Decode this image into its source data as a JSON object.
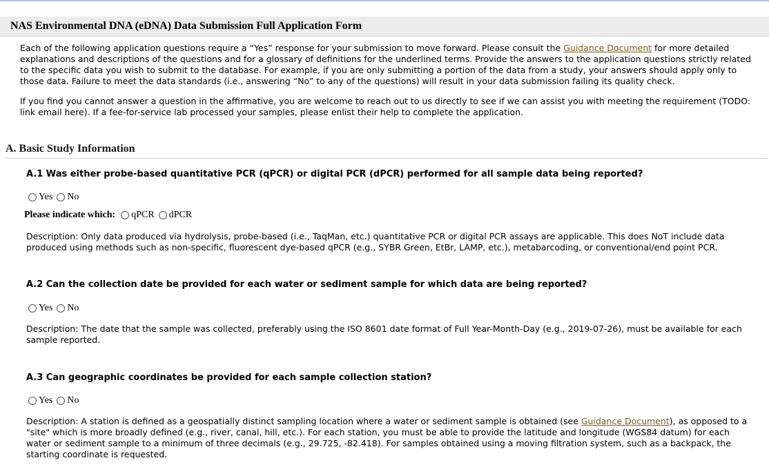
{
  "header": {
    "title": "NAS Environmental DNA (eDNA) Data Submission Full Application Form"
  },
  "intro": {
    "p1_before": "Each of the following application questions require a “Yes” response for your submission to move forward. Please consult the ",
    "p1_link": "Guidance Document",
    "p1_after": " for more detailed explanations and descriptions of the questions and for a glossary of definitions for the underlined terms. Provide the answers to the application questions strictly related to the specific data you wish to submit to the database. For example, if you are only submitting a portion of the data from a study, your answers should apply only to those data. Failure to meet the data standards (i.e., answering “No” to any of the questions) will result in your data submission failing its quality check.",
    "p2": "If you find you cannot answer a question in the affirmative, you are welcome to reach out to us directly to see if we can assist you with meeting the requirement (TODO: link email here). If a fee-for-service lab processed your samples, please enlist their help to complete the application."
  },
  "section": {
    "title": "A. Basic Study Information"
  },
  "questions": [
    {
      "text": "A.1 Was either probe-based quantitative PCR (qPCR) or digital PCR (dPCR) performed for all sample data being reported?",
      "yes": "Yes",
      "no": "No",
      "which_label": "Please indicate which:",
      "which_opt1": "qPCR",
      "which_opt2": "dPCR",
      "desc": "Description: Only data produced via hydrolysis, probe-based (i.e., TaqMan, etc.) quantitative PCR or digital PCR assays are applicable. This does NoT include data produced using methods such as non-specific, fluorescent dye-based qPCR (e.g., SYBR Green, EtBr, LAMP, etc.), metabarcoding, or conventional/end point PCR."
    },
    {
      "text": "A.2 Can the collection date be provided for each water or sediment sample for which data are being reported?",
      "yes": "Yes",
      "no": "No",
      "desc": "Description: The date that the sample was collected, preferably using the ISO 8601 date format of Full Year-Month-Day (e.g., 2019-07-26), must be available for each sample reported."
    },
    {
      "text": "A.3 Can geographic coordinates be provided for each sample collection station?",
      "yes": "Yes",
      "no": "No",
      "desc_before": "Description: A station is defined as a geospatially distinct sampling location where a water or sediment sample is obtained (see ",
      "desc_link": "Guidance Document",
      "desc_after": "), as opposed to a \"site\" which is more broadly defined (e.g., river, canal, hill, etc.). For each station, you must be able to provide the latitude and longitude (WGS84 datum) for each water or sediment sample to a minimum of three decimals (e.g., 29.725, -82.418). For samples obtained using a moving filtration system, such as a backpack, the starting coordinate is requested."
    }
  ]
}
